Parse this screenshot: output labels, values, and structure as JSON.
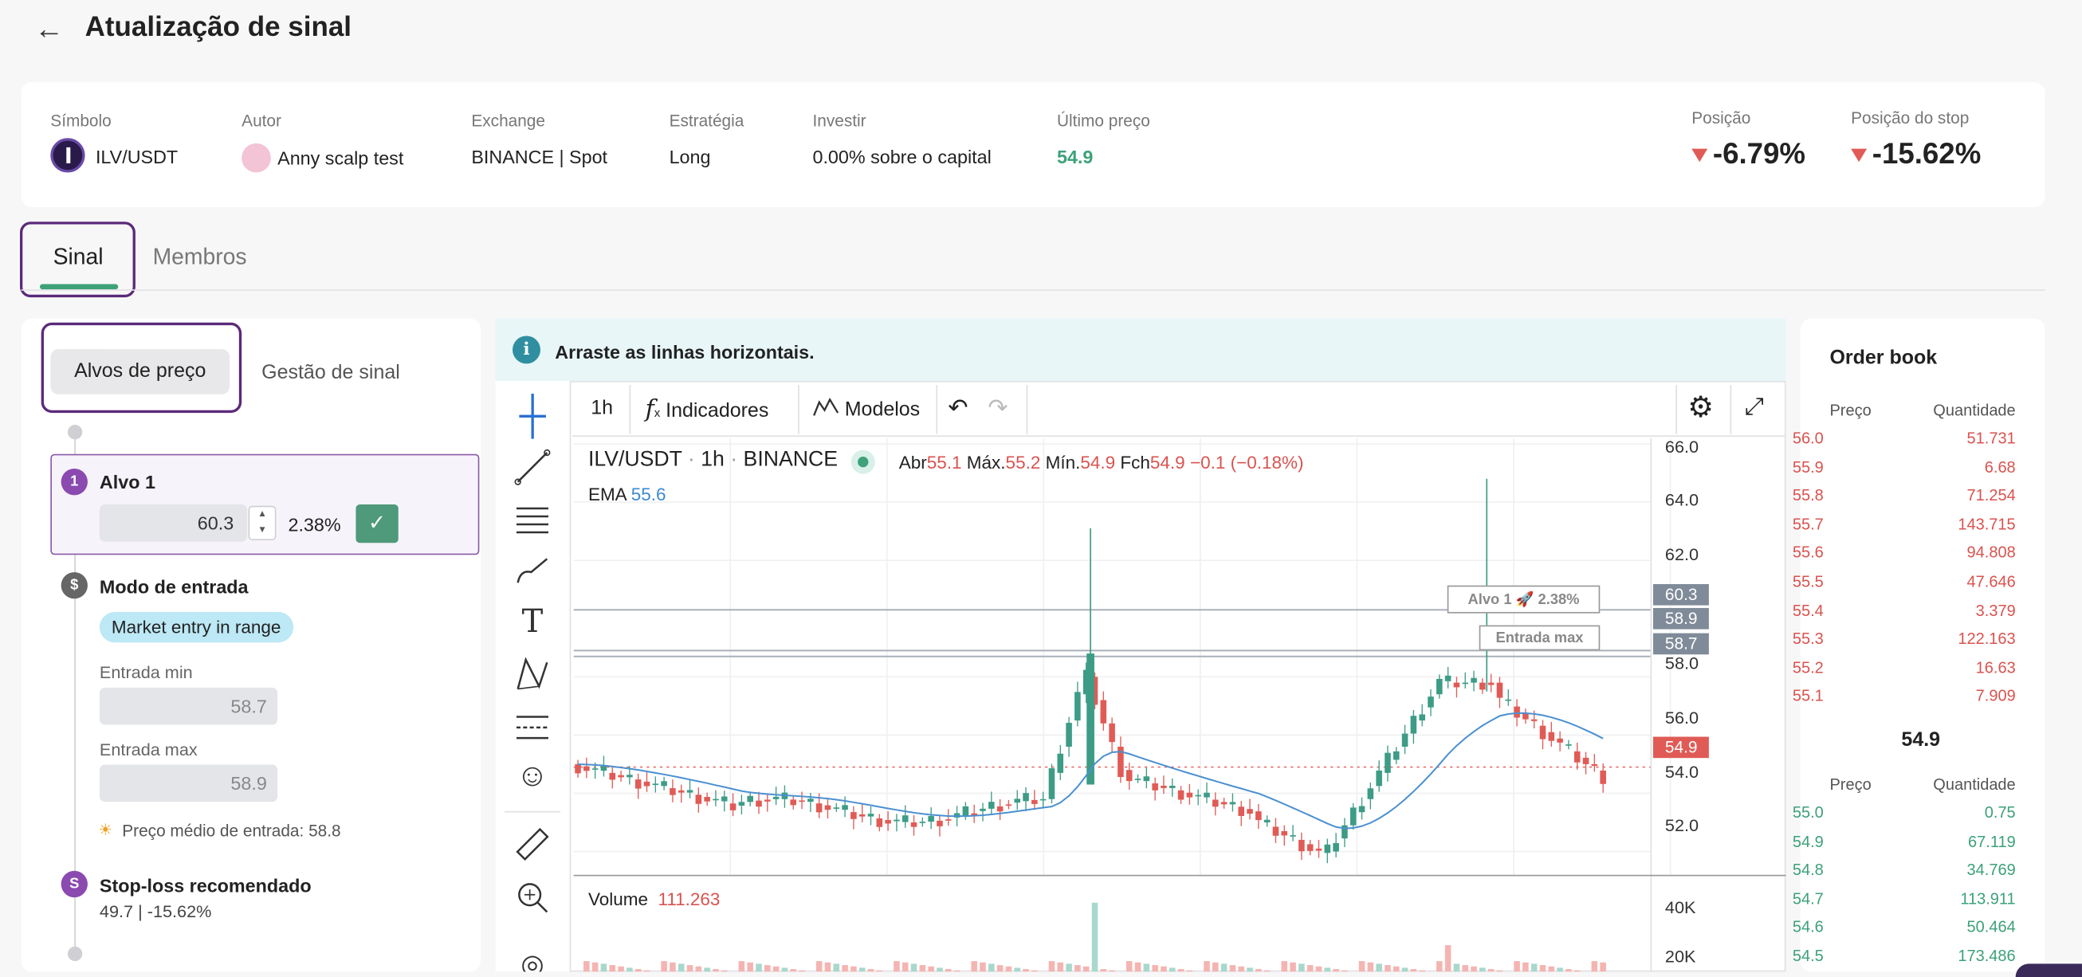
{
  "header": {
    "title": "Atualização de sinal",
    "back_icon": "arrow-left-icon"
  },
  "info": {
    "simbolo_label": "Símbolo",
    "simbolo": "ILV/USDT",
    "autor_label": "Autor",
    "autor": "Anny scalp test",
    "exchange_label": "Exchange",
    "exchange": "BINANCE | Spot",
    "estrategia_label": "Estratégia",
    "estrategia": "Long",
    "investir_label": "Investir",
    "investir": "0.00% sobre o capital",
    "ultimo_label": "Último preço",
    "ultimo": "54.9",
    "posicao_label": "Posição",
    "posicao": "-6.79%",
    "stop_label": "Posição do stop",
    "stop": "-15.62%"
  },
  "tabs": {
    "sinal": "Sinal",
    "membros": "Membros"
  },
  "side": {
    "tab_alvos": "Alvos de preço",
    "tab_gestao": "Gestão de sinal",
    "alvo1": {
      "num": "1",
      "title": "Alvo 1",
      "value": "60.3",
      "pct": "2.38%"
    },
    "entrada": {
      "num": "$",
      "title": "Modo de entrada",
      "badge": "Market entry in range",
      "min_label": "Entrada min",
      "min": "58.7",
      "max_label": "Entrada max",
      "max": "58.9",
      "medio": "Preço médio de entrada: 58.8"
    },
    "stop": {
      "num": "S",
      "title": "Stop-loss recomendado",
      "value": "49.7 | -15.62%"
    }
  },
  "chart_panel": {
    "notice": "Arraste as linhas horizontais.",
    "toolbar": {
      "interval": "1h",
      "indicadores": "Indicadores",
      "modelos": "Modelos"
    },
    "legend": {
      "symbol": "ILV/USDT",
      "interval": "1h",
      "exchange": "BINANCE",
      "abr_l": "Abr",
      "abr": "55.1",
      "max_l": "Máx.",
      "max": "55.2",
      "min_l": "Mín.",
      "min": "54.9",
      "fch_l": "Fch",
      "fch": "54.9",
      "chg": "−0.1 (−0.18%)",
      "ema_l": "EMA",
      "ema": "55.6"
    },
    "alvo_label": "Alvo 1 🚀 2.38%",
    "entrada_label": "Entrada max",
    "volume_l": "Volume",
    "volume": "111.263",
    "axis": [
      "66.0",
      "64.0",
      "62.0",
      "58.0",
      "56.0",
      "54.0",
      "52.0"
    ],
    "tags": {
      "alvo": "60.3",
      "max": "58.9",
      "min": "58.7",
      "last": "54.9"
    },
    "vol_axis": [
      "40K",
      "20K"
    ]
  },
  "chart_data": {
    "type": "candlestick",
    "symbol": "ILV/USDT",
    "interval": "1h",
    "exchange": "BINANCE",
    "ylim": [
      51.2,
      66.2
    ],
    "y_ticks": [
      52.0,
      54.0,
      56.0,
      58.0,
      62.0,
      64.0,
      66.0
    ],
    "lines": {
      "alvo_1": 60.3,
      "entrada_max": 58.9,
      "entrada_min": 58.7,
      "last": 54.9
    },
    "ema": 55.6,
    "last_candle": {
      "open": 55.1,
      "high": 55.2,
      "low": 54.9,
      "close": 54.9
    }
  },
  "orderbook": {
    "title": "Order book",
    "col_price": "Preço",
    "col_qty": "Quantidade",
    "asks": [
      [
        "56.0",
        "51.731"
      ],
      [
        "55.9",
        "6.68"
      ],
      [
        "55.8",
        "71.254"
      ],
      [
        "55.7",
        "143.715"
      ],
      [
        "55.6",
        "94.808"
      ],
      [
        "55.5",
        "47.646"
      ],
      [
        "55.4",
        "3.379"
      ],
      [
        "55.3",
        "122.163"
      ],
      [
        "55.2",
        "16.63"
      ],
      [
        "55.1",
        "7.909"
      ]
    ],
    "mid": "54.9",
    "bids": [
      [
        "55.0",
        "0.75"
      ],
      [
        "54.9",
        "67.119"
      ],
      [
        "54.8",
        "34.769"
      ],
      [
        "54.7",
        "113.911"
      ],
      [
        "54.6",
        "50.464"
      ],
      [
        "54.5",
        "173.486"
      ]
    ]
  }
}
